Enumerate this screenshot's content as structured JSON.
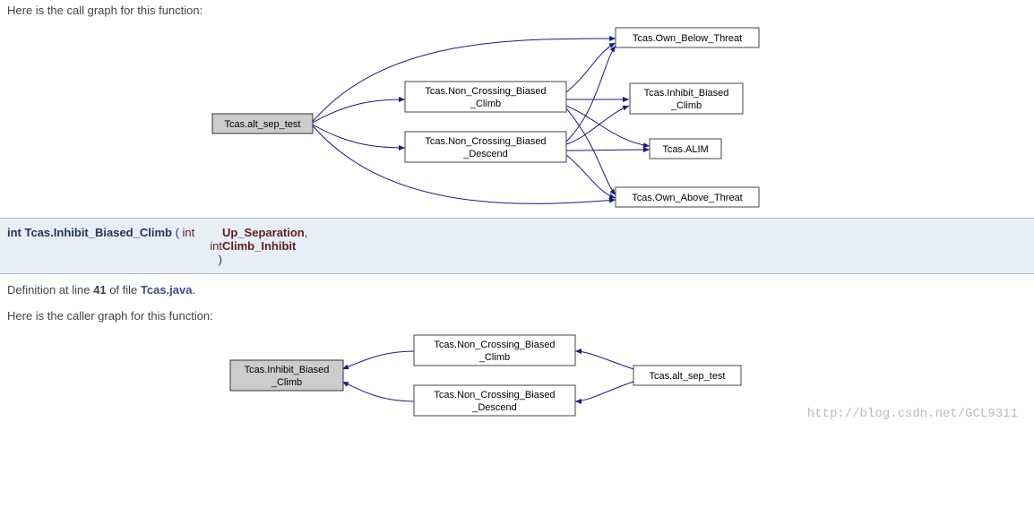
{
  "section_call_graph": "Here is the call graph for this function:",
  "section_caller_graph": "Here is the caller graph for this function:",
  "call_graph": {
    "root": "Tcas.alt_sep_test",
    "mid1_a": "Tcas.Non_Crossing_Biased",
    "mid1_b": "_Climb",
    "mid2_a": "Tcas.Non_Crossing_Biased",
    "mid2_b": "_Descend",
    "out1": "Tcas.Own_Below_Threat",
    "out2_a": "Tcas.Inhibit_Biased",
    "out2_b": "_Climb",
    "out3": "Tcas.ALIM",
    "out4": "Tcas.Own_Above_Threat"
  },
  "signature": {
    "ret_and_name": "int Tcas.Inhibit_Biased_Climb",
    "open": "( ",
    "type1": "int  ",
    "param1": "Up_Separation",
    "comma": ",",
    "type2": "int  ",
    "param2": "Climb_Inhibit",
    "close": ")"
  },
  "definition": {
    "prefix": "Definition at line ",
    "line": "41",
    "middle": " of file ",
    "file": "Tcas.java",
    "suffix": "."
  },
  "caller_graph": {
    "root_a": "Tcas.Inhibit_Biased",
    "root_b": "_Climb",
    "mid1_a": "Tcas.Non_Crossing_Biased",
    "mid1_b": "_Climb",
    "mid2_a": "Tcas.Non_Crossing_Biased",
    "mid2_b": "_Descend",
    "out": "Tcas.alt_sep_test"
  },
  "watermark": "http://blog.csdn.net/GCL9311"
}
